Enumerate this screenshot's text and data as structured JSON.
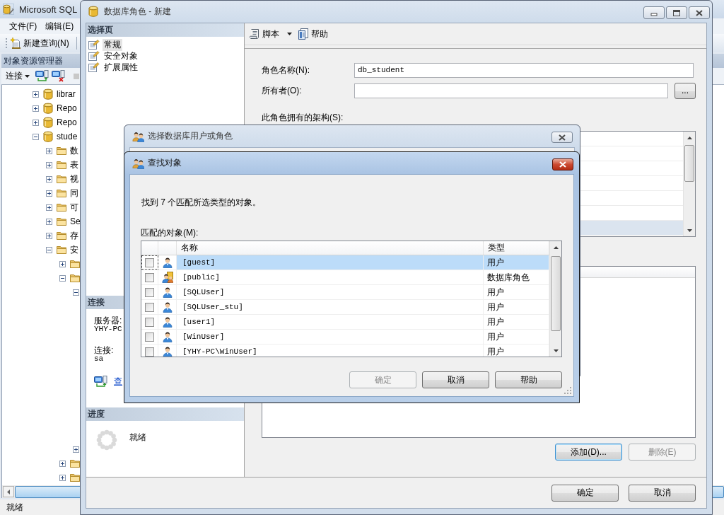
{
  "main_window": {
    "title": "Microsoft SQL",
    "menu": [
      "文件(F)",
      "编辑(E)"
    ],
    "toolbar": [
      {
        "label": "新建查询(N)"
      }
    ],
    "object_explorer": {
      "title": "对象资源管理器",
      "connect": "连接",
      "tree": [
        {
          "kind": "database",
          "label": "librar",
          "expanded": false
        },
        {
          "kind": "database",
          "label": "Repo",
          "expanded": false
        },
        {
          "kind": "database",
          "label": "Repo",
          "expanded": false
        },
        {
          "kind": "database",
          "label": "stude",
          "expanded": true,
          "children": [
            {
              "kind": "folder",
              "label": "数",
              "expanded": false
            },
            {
              "kind": "folder",
              "label": "表",
              "expanded": false
            },
            {
              "kind": "folder",
              "label": "视",
              "expanded": false
            },
            {
              "kind": "folder",
              "label": "同",
              "expanded": false
            },
            {
              "kind": "folder",
              "label": "可",
              "expanded": false
            },
            {
              "kind": "folder",
              "label": "Se",
              "expanded": false
            },
            {
              "kind": "folder",
              "label": "存",
              "expanded": false
            },
            {
              "kind": "folder",
              "label": "安",
              "expanded": true,
              "children": [
                {
                  "kind": "folder",
                  "expanded": false
                },
                {
                  "kind": "folder",
                  "expanded": true,
                  "children": [
                    {
                      "expanded": true
                    },
                    {
                      "expanded": false
                    }
                  ]
                },
                {
                  "kind": "folder",
                  "expanded": false
                },
                {
                  "kind": "folder",
                  "expanded": false
                }
              ]
            }
          ]
        }
      ]
    },
    "status_bar": "就绪"
  },
  "role_dialog": {
    "title": "数据库角色 - 新建",
    "active": false,
    "pages_header": "选择页",
    "pages": [
      {
        "label": "常规",
        "selected": true
      },
      {
        "label": "安全对象",
        "selected": false
      },
      {
        "label": "扩展属性",
        "selected": false
      }
    ],
    "connection_header": "连接",
    "connection": [
      {
        "label": "服务器:",
        "value": "YHY-PC"
      },
      {
        "label": "连接:",
        "value": "sa"
      }
    ],
    "connection_link": "查",
    "progress_header": "进度",
    "progress_status": "就绪",
    "toolbar": [
      {
        "kind": "script",
        "label": "脚本"
      },
      {
        "kind": "help",
        "label": "帮助"
      }
    ],
    "fields": [
      {
        "label": "角色名称(N):",
        "value": "db_student"
      },
      {
        "label": "所有者(O):",
        "browse": "..."
      }
    ],
    "schemas": {
      "label": "此角色拥有的架构(S):",
      "rows": [
        {
          "selected": false
        },
        {
          "selected": false
        },
        {
          "selected": false
        },
        {
          "selected": false
        },
        {
          "selected": false
        },
        {
          "selected": false
        },
        {
          "selected": true
        }
      ]
    },
    "member_buttons": [
      {
        "label": "添加(D)...",
        "disabled": false,
        "focused": true
      },
      {
        "label": "删除(E)",
        "disabled": true,
        "focused": false
      }
    ],
    "buttons": [
      {
        "label": "确定"
      },
      {
        "label": "取消"
      }
    ]
  },
  "select_dialog": {
    "title": "选择数据库用户或角色",
    "active": false
  },
  "find_dialog": {
    "title": "查找对象",
    "active": true,
    "message": "找到 7 个匹配所选类型的对象。",
    "list_label": "匹配的对象(M):",
    "columns": [
      "名称",
      "类型"
    ],
    "rows": [
      {
        "kind": "user",
        "name": "[guest]",
        "type": "用户",
        "checked": false,
        "selected": true
      },
      {
        "kind": "role",
        "name": "[public]",
        "type": "数据库角色",
        "checked": false,
        "selected": false
      },
      {
        "kind": "user",
        "name": "[SQLUser]",
        "type": "用户",
        "checked": false,
        "selected": false
      },
      {
        "kind": "user",
        "name": "[SQLUser_stu]",
        "type": "用户",
        "checked": false,
        "selected": false
      },
      {
        "kind": "user",
        "name": "[user1]",
        "type": "用户",
        "checked": false,
        "selected": false
      },
      {
        "kind": "user",
        "name": "[WinUser]",
        "type": "用户",
        "checked": false,
        "selected": false
      },
      {
        "kind": "user",
        "name": "[YHY-PC\\WinUser]",
        "type": "用户",
        "checked": false,
        "selected": false
      }
    ],
    "buttons": [
      {
        "label": "确定",
        "disabled": true
      },
      {
        "label": "取消",
        "disabled": false
      },
      {
        "label": "帮助",
        "disabled": false
      }
    ]
  }
}
